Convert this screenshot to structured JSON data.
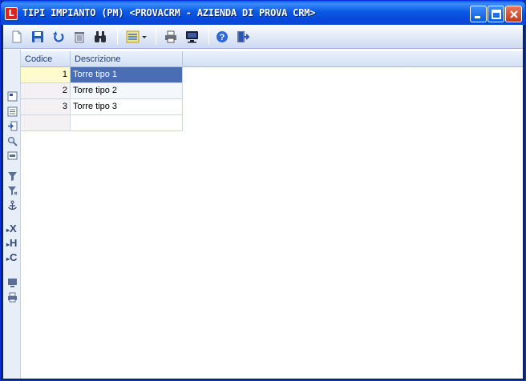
{
  "window": {
    "title": "TIPI IMPIANTO (PM) <PROVACRM - AZIENDA DI PROVA CRM>",
    "app_icon_letter": "L",
    "controls": [
      "minimize",
      "maximize",
      "close"
    ]
  },
  "toolbar": {
    "buttons": [
      {
        "name": "new-icon",
        "tooltip": ""
      },
      {
        "name": "save-icon",
        "tooltip": ""
      },
      {
        "name": "undo-icon",
        "tooltip": ""
      },
      {
        "name": "delete-icon",
        "tooltip": ""
      },
      {
        "name": "binoculars-icon",
        "tooltip": ""
      },
      {
        "name": "view-options-icon",
        "tooltip": ""
      },
      {
        "name": "print-icon",
        "tooltip": ""
      },
      {
        "name": "preview-icon",
        "tooltip": ""
      },
      {
        "name": "help-icon",
        "tooltip": ""
      },
      {
        "name": "exit-icon",
        "tooltip": ""
      }
    ]
  },
  "sidebar": {
    "labels": {
      "x": "X",
      "h": "H",
      "c": "C"
    }
  },
  "grid": {
    "columns": [
      "Codice",
      "Descrizione"
    ],
    "rows": [
      {
        "codice": "1",
        "descrizione": "Torre tipo 1",
        "selected": true
      },
      {
        "codice": "2",
        "descrizione": "Torre tipo 2",
        "selected": false
      },
      {
        "codice": "3",
        "descrizione": "Torre tipo 3",
        "selected": false
      },
      {
        "codice": "",
        "descrizione": "",
        "selected": false
      }
    ]
  },
  "colors": {
    "titlebar": "#0a5ae6",
    "selection": "#4a6db4",
    "active_cell": "#fffbcc"
  }
}
